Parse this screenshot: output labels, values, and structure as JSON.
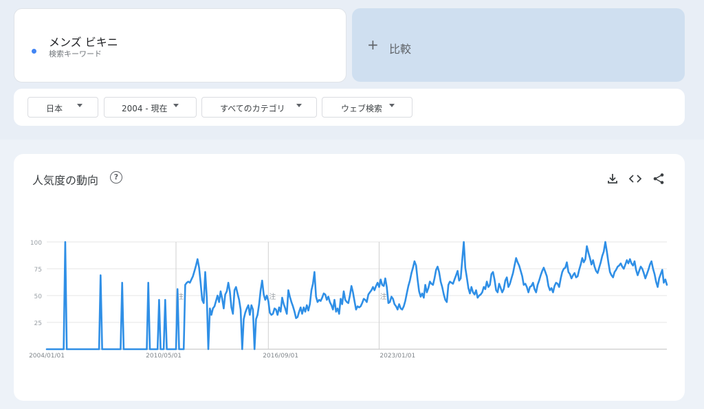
{
  "search_term": {
    "name": "メンズ ビキニ",
    "type_label": "検索キーワード",
    "color": "#4285f4"
  },
  "compare": {
    "plus": "+",
    "label": "比較"
  },
  "filters": {
    "region": "日本",
    "period": "2004 - 現在",
    "category": "すべてのカテゴリ",
    "search_type": "ウェブ検索"
  },
  "chart_section": {
    "title": "人気度の動向",
    "help_icon": "question-circle-icon",
    "actions": [
      "download-icon",
      "embed-code-icon",
      "share-icon"
    ]
  },
  "chart_data": {
    "type": "line",
    "title": "",
    "xlabel": "",
    "ylabel": "",
    "ylim": [
      0,
      100
    ],
    "yticks": [
      25,
      50,
      75,
      100
    ],
    "x_tick_labels": [
      "2004/01/01",
      "2010/05/01",
      "2016/09/01",
      "2023/01/01"
    ],
    "annotation_marker": "注",
    "annotation_dates": [
      "2011/01/01",
      "2016/01/01",
      "2022/01/01"
    ],
    "series": [
      {
        "color": "#2f8fe6",
        "values": [
          0,
          0,
          0,
          0,
          0,
          0,
          0,
          0,
          0,
          0,
          0,
          0,
          100,
          0,
          0,
          0,
          0,
          0,
          0,
          0,
          0,
          0,
          0,
          0,
          0,
          0,
          0,
          0,
          0,
          0,
          0,
          0,
          0,
          0,
          0,
          69,
          0,
          0,
          0,
          0,
          0,
          0,
          0,
          0,
          0,
          0,
          0,
          0,
          0,
          62,
          0,
          0,
          0,
          0,
          0,
          0,
          0,
          0,
          0,
          0,
          0,
          0,
          0,
          0,
          0,
          0,
          62,
          0,
          0,
          0,
          0,
          0,
          0,
          46,
          0,
          0,
          0,
          46,
          0,
          0,
          0,
          0,
          0,
          0,
          0,
          56,
          0,
          0,
          0,
          0,
          60,
          62,
          63,
          62,
          65,
          68,
          73,
          78,
          84,
          76,
          62,
          46,
          43,
          72,
          48,
          0,
          38,
          32,
          38,
          40,
          45,
          50,
          44,
          54,
          47,
          38,
          51,
          54,
          62,
          54,
          39,
          33,
          55,
          58,
          52,
          46,
          37,
          0,
          28,
          34,
          38,
          41,
          32,
          41,
          37,
          0,
          28,
          32,
          42,
          55,
          64,
          51,
          46,
          50,
          45,
          34,
          32,
          33,
          38,
          37,
          32,
          39,
          35,
          48,
          42,
          38,
          33,
          55,
          49,
          44,
          40,
          35,
          29,
          30,
          35,
          39,
          33,
          39,
          35,
          41,
          36,
          42,
          55,
          61,
          72,
          49,
          44,
          46,
          45,
          48,
          52,
          51,
          46,
          49,
          44,
          41,
          37,
          46,
          35,
          38,
          33,
          47,
          42,
          54,
          46,
          44,
          43,
          50,
          59,
          53,
          45,
          37,
          40,
          39,
          40,
          43,
          47,
          46,
          44,
          51,
          53,
          55,
          58,
          55,
          59,
          62,
          58,
          65,
          60,
          59,
          66,
          58,
          43,
          44,
          49,
          47,
          42,
          40,
          37,
          42,
          38,
          37,
          40,
          45,
          52,
          59,
          64,
          71,
          76,
          82,
          78,
          65,
          54,
          49,
          52,
          48,
          60,
          53,
          57,
          63,
          61,
          60,
          66,
          74,
          77,
          72,
          63,
          58,
          51,
          46,
          44,
          60,
          63,
          62,
          61,
          65,
          69,
          73,
          64,
          66,
          83,
          100,
          76,
          67,
          57,
          52,
          58,
          53,
          51,
          55,
          48,
          50,
          51,
          53,
          58,
          56,
          63,
          58,
          60,
          70,
          72,
          65,
          55,
          53,
          61,
          57,
          53,
          56,
          64,
          67,
          58,
          61,
          66,
          71,
          78,
          85,
          81,
          78,
          73,
          68,
          60,
          61,
          58,
          53,
          58,
          59,
          62,
          56,
          53,
          60,
          64,
          69,
          73,
          76,
          72,
          68,
          59,
          55,
          57,
          53,
          59,
          62,
          61,
          58,
          66,
          72,
          75,
          76,
          81,
          72,
          70,
          66,
          69,
          71,
          67,
          68,
          74,
          79,
          85,
          81,
          84,
          96,
          90,
          85,
          79,
          83,
          77,
          73,
          71,
          76,
          81,
          87,
          91,
          100,
          91,
          81,
          72,
          69,
          67,
          72,
          74,
          77,
          78,
          80,
          77,
          75,
          79,
          83,
          80,
          84,
          80,
          78,
          82,
          74,
          69,
          73,
          77,
          75,
          71,
          66,
          70,
          74,
          79,
          82,
          75,
          70,
          63,
          58,
          66,
          70,
          74,
          62,
          65,
          60
        ]
      }
    ]
  }
}
